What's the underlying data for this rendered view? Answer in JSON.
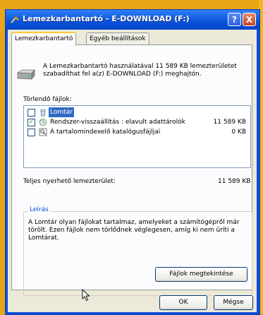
{
  "window": {
    "title": "Lemezkarbantartó - E-DOWNLOAD (F:)",
    "help_label": "?",
    "close_label": "X"
  },
  "tabs": [
    {
      "label": "Lemezkarbantartó"
    },
    {
      "label": "Egyéb beállítások"
    }
  ],
  "description": "A Lemezkarbantartó használatával 11 589 KB lemezterületet szabadíthat fel a(z) E-DOWNLOAD (F:) meghajtón.",
  "files_label": "Törlendő fájlok:",
  "files": [
    {
      "label": "Lomtár",
      "size": "0 KB",
      "checked": false,
      "selected": true,
      "icon": "recycle-bin-icon"
    },
    {
      "label": "Rendszer-visszaállítás : elavult adattárolók",
      "size": "11 589 KB",
      "checked": true,
      "selected": false,
      "icon": "system-restore-icon"
    },
    {
      "label": "A tartalomindexelő katalógusfájljai",
      "size": "0 KB",
      "checked": false,
      "selected": false,
      "icon": "index-catalog-icon"
    }
  ],
  "total": {
    "label": "Teljes nyerhető lemezterület:",
    "value": "11 589 KB"
  },
  "description_group": {
    "legend": "Leírás",
    "text": "A Lomtár olyan fájlokat tartalmaz, amelyeket a számítógépről már törölt. Ezen fájlok nem törlődnek véglegesen, amíg ki nem üríti a Lomtárat."
  },
  "buttons": {
    "view_files": "Fájlok megtekintése",
    "ok": "OK",
    "cancel": "Mégse"
  },
  "colors": {
    "titlebar": "#0852db",
    "selection": "#316ac5",
    "legend": "#0046d5"
  }
}
